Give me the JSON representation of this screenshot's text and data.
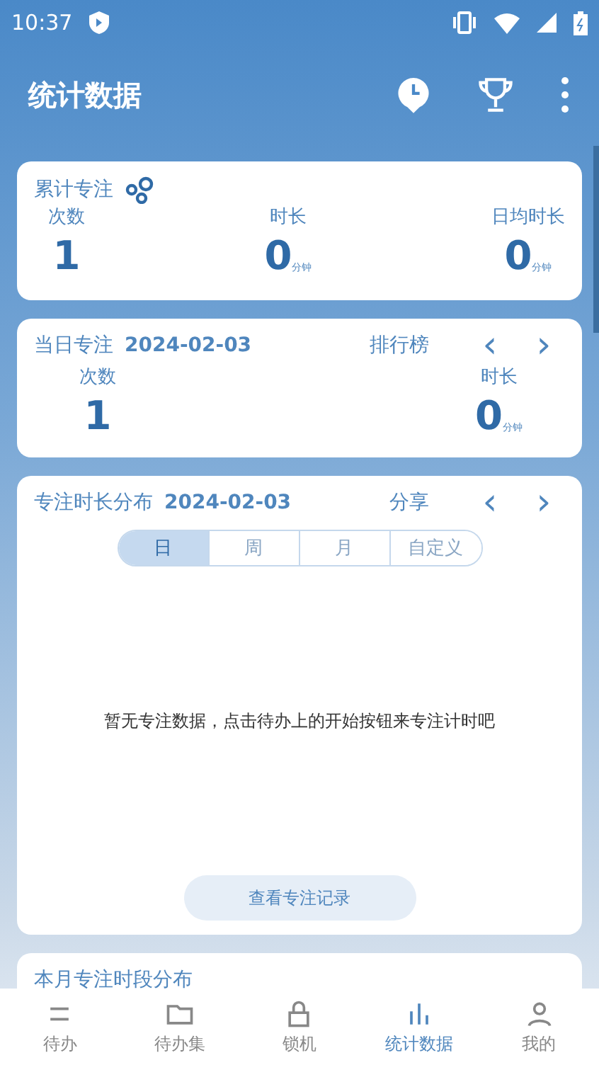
{
  "status_bar": {
    "time": "10:37"
  },
  "app_bar": {
    "title": "统计数据"
  },
  "total_card": {
    "title": "累计专注",
    "stats": [
      {
        "label": "次数",
        "value": "1"
      },
      {
        "label": "时长",
        "value": "0",
        "unit": "分钟"
      },
      {
        "label": "日均时长",
        "value": "0",
        "unit": "分钟"
      }
    ]
  },
  "day_card": {
    "title": "当日专注",
    "date": "2024-02-03",
    "action": "排行榜",
    "prev": "‹",
    "next": "›",
    "stats": [
      {
        "label": "次数",
        "value": "1"
      },
      {
        "label": "时长",
        "value": "0",
        "unit": "分钟"
      }
    ]
  },
  "distribution_card": {
    "title": "专注时长分布",
    "date": "2024-02-03",
    "action": "分享",
    "prev": "‹",
    "next": "›",
    "tabs": [
      {
        "label": "日",
        "selected": true
      },
      {
        "label": "周",
        "selected": false
      },
      {
        "label": "月",
        "selected": false
      },
      {
        "label": "自定义",
        "selected": false
      }
    ],
    "empty_message": "暂无专注数据，点击待办上的开始按钮来专注计时吧",
    "button": "查看专注记录"
  },
  "month_card": {
    "title": "本月专注时段分布"
  },
  "bottom_nav": [
    {
      "label": "待办",
      "kind": "list",
      "selected": false
    },
    {
      "label": "待办集",
      "kind": "folder",
      "selected": false
    },
    {
      "label": "锁机",
      "kind": "lock",
      "selected": false
    },
    {
      "label": "统计数据",
      "kind": "chart",
      "selected": true
    },
    {
      "label": "我的",
      "kind": "person",
      "selected": false
    }
  ]
}
